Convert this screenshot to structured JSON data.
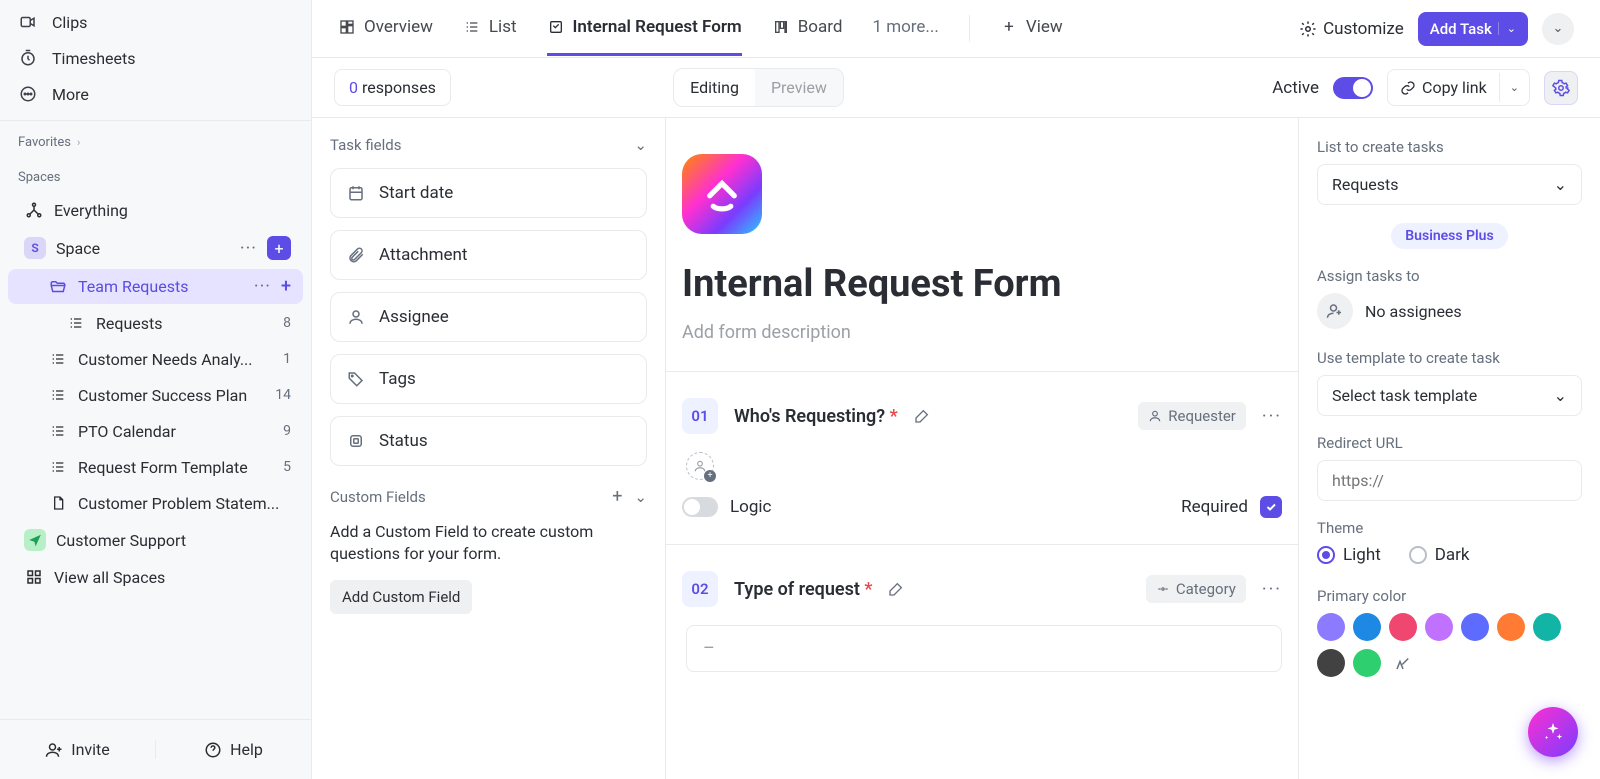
{
  "sidebar": {
    "clips": "Clips",
    "timesheets": "Timesheets",
    "more": "More",
    "favorites": "Favorites",
    "spaces": "Spaces",
    "everything": "Everything",
    "space": "Space",
    "spaceInitial": "S",
    "teamRequests": "Team Requests",
    "requests": "Requests",
    "requestsCount": "8",
    "custNeeds": "Customer Needs Analy...",
    "custNeedsCount": "1",
    "custSuccess": "Customer Success Plan",
    "custSuccessCount": "14",
    "pto": "PTO Calendar",
    "ptoCount": "9",
    "reqForm": "Request Form Template",
    "reqFormCount": "5",
    "custProblem": "Customer Problem Statem...",
    "custSupport": "Customer Support",
    "viewAll": "View all Spaces",
    "invite": "Invite",
    "help": "Help"
  },
  "tabs": {
    "overview": "Overview",
    "list": "List",
    "form": "Internal Request Form",
    "board": "Board",
    "more": "1 more...",
    "view": "View",
    "customize": "Customize",
    "addTask": "Add Task"
  },
  "toolbar": {
    "respCount": "0",
    "respLabel": " responses",
    "editing": "Editing",
    "preview": "Preview",
    "active": "Active",
    "copy": "Copy link"
  },
  "leftPanel": {
    "taskFields": "Task fields",
    "fields": [
      "Start date",
      "Attachment",
      "Assignee",
      "Tags",
      "Status"
    ],
    "customFields": "Custom Fields",
    "hint": "Add a Custom Field to create custom questions for your form.",
    "add": "Add Custom Field"
  },
  "form": {
    "title": "Internal Request Form",
    "descPlaceholder": "Add form description",
    "q": [
      {
        "num": "01",
        "title": "Who's Requesting?",
        "tag": "Requester",
        "logic": "Logic",
        "required": "Required"
      },
      {
        "num": "02",
        "title": "Type of request",
        "tag": "Category",
        "placeholder": "–"
      }
    ]
  },
  "rightPanel": {
    "listLabel": "List to create tasks",
    "listSel": "Requests",
    "plan": "Business Plus",
    "assignLabel": "Assign tasks to",
    "noAssignees": "No assignees",
    "tmplLabel": "Use template to create task",
    "tmplSel": "Select task template",
    "redirectLabel": "Redirect URL",
    "redirectPh": "https://",
    "themeLabel": "Theme",
    "light": "Light",
    "dark": "Dark",
    "primaryLabel": "Primary color",
    "swatches": [
      "#8d7bff",
      "#1e88e5",
      "#ef476f",
      "#c071ff",
      "#5d6cff",
      "#ff7a33",
      "#12b5a5",
      "#424242",
      "#2ecf6e"
    ]
  }
}
